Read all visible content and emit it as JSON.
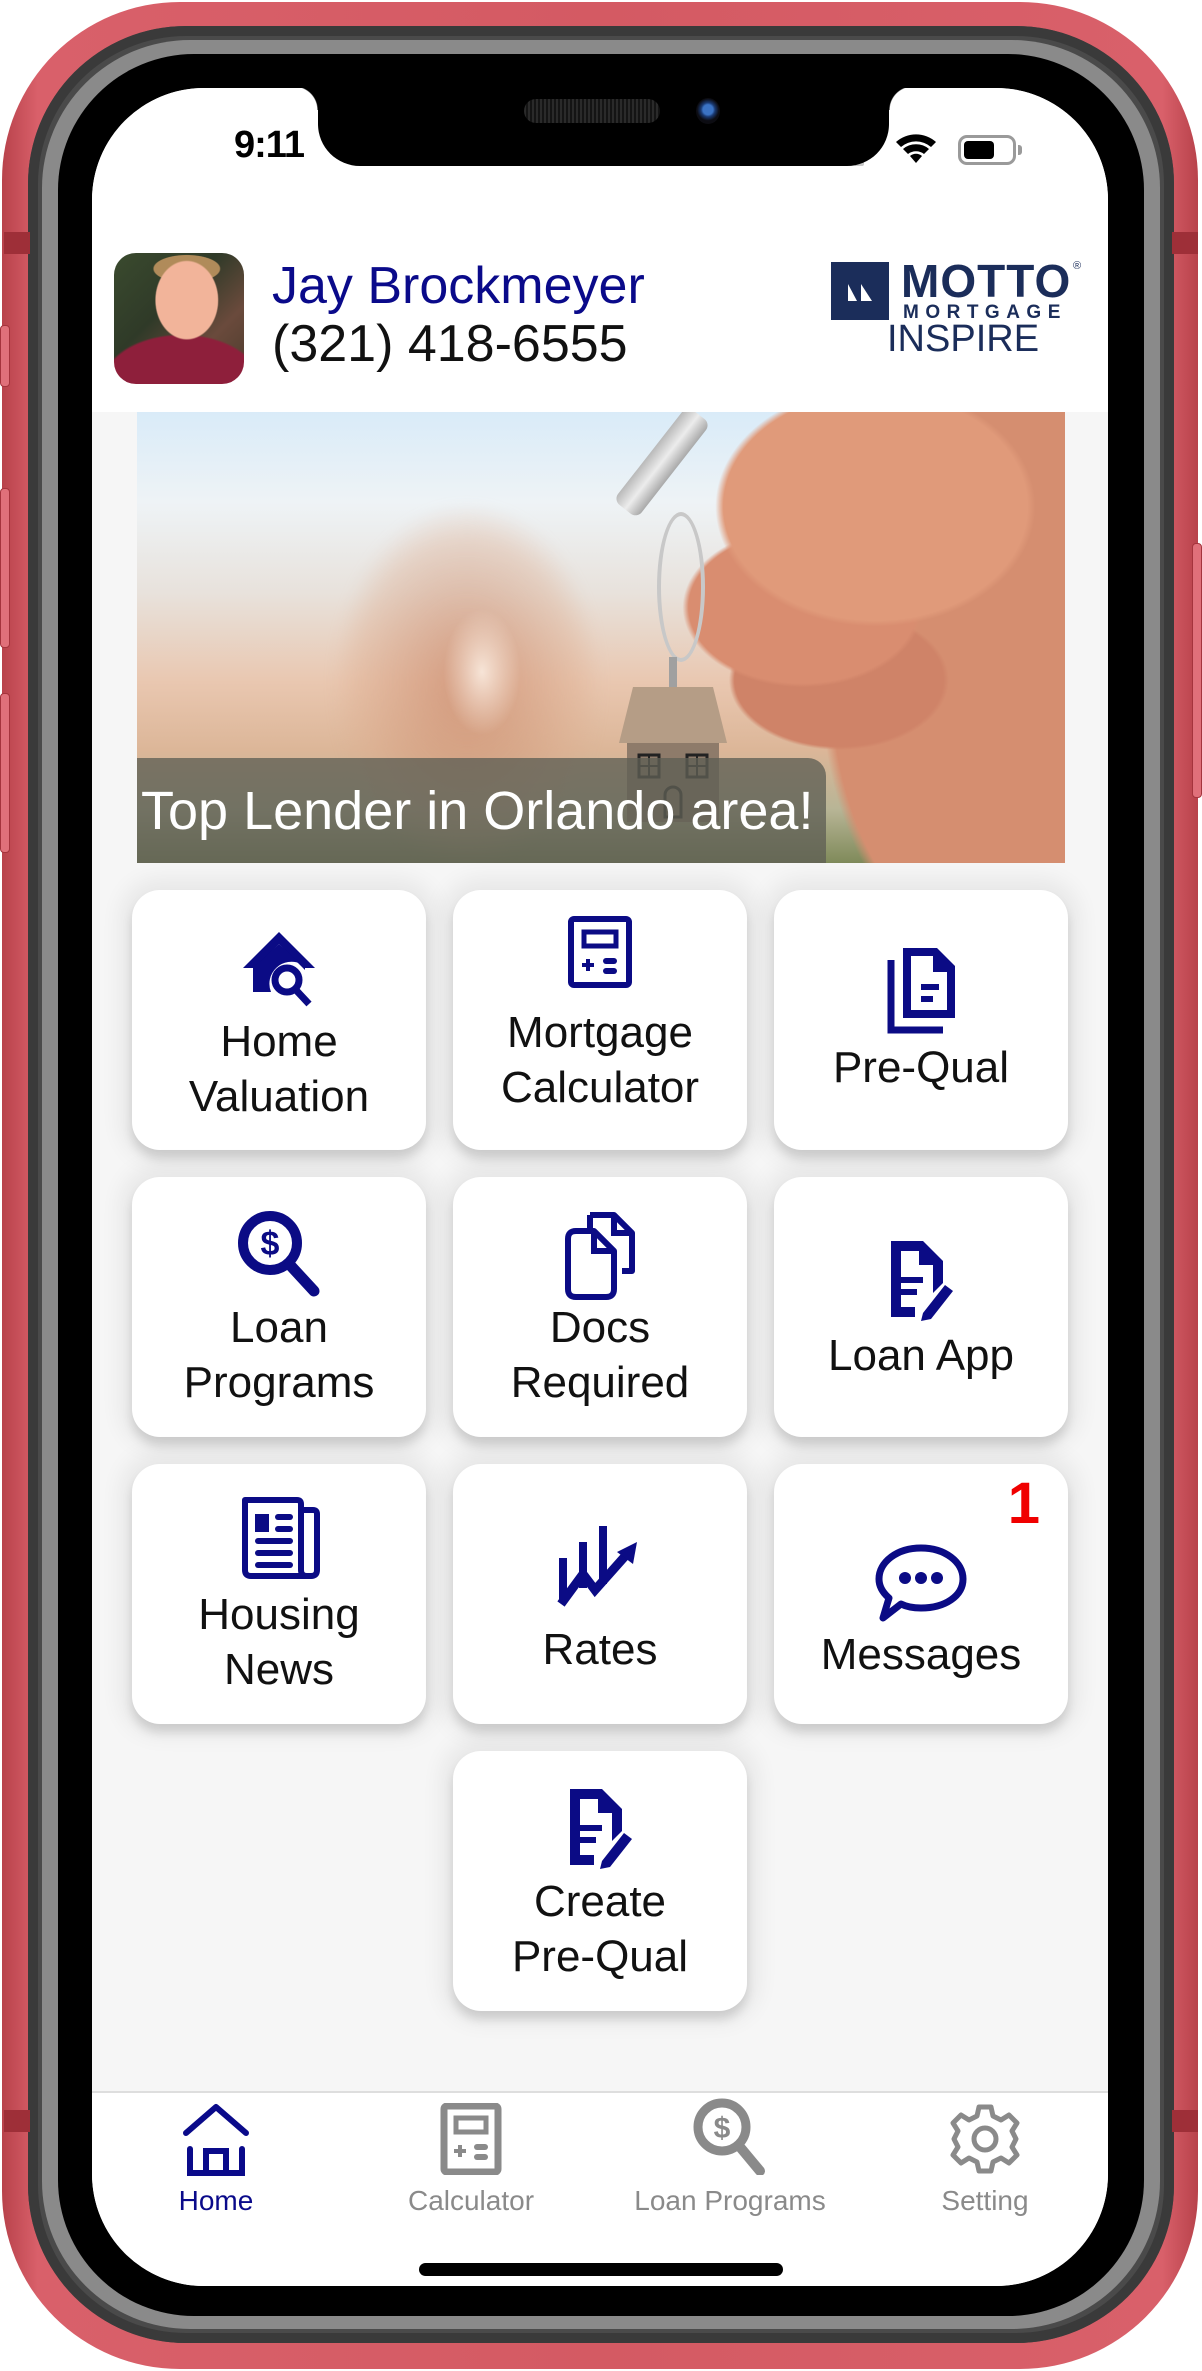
{
  "status_bar": {
    "time": "9:11",
    "icons": [
      "cellular-signal-icon",
      "wifi-icon",
      "battery-icon"
    ]
  },
  "header": {
    "agent_name": "Jay Brockmeyer",
    "agent_phone": "(321) 418-6555",
    "avatar": "agent-photo",
    "logo": {
      "brand": "MOTTO",
      "registered_mark": "®",
      "subtitle": "MORTGAGE",
      "office": "INSPIRE"
    }
  },
  "banner": {
    "caption": "Top Lender in Orlando area!",
    "image": "hand-holding-house-keychain"
  },
  "tiles": [
    {
      "label_lines": [
        "Home",
        "Valuation"
      ],
      "icon": "home-search-icon"
    },
    {
      "label_lines": [
        "Mortgage",
        "Calculator"
      ],
      "icon": "calculator-icon"
    },
    {
      "label_lines": [
        "Pre-Qual"
      ],
      "icon": "document-copy-icon"
    },
    {
      "label_lines": [
        "Loan",
        "Programs"
      ],
      "icon": "dollar-search-icon"
    },
    {
      "label_lines": [
        "Docs",
        "Required"
      ],
      "icon": "documents-icon"
    },
    {
      "label_lines": [
        "Loan App"
      ],
      "icon": "document-edit-icon"
    },
    {
      "label_lines": [
        "Housing",
        "News"
      ],
      "icon": "newspaper-icon"
    },
    {
      "label_lines": [
        "Rates"
      ],
      "icon": "chart-trend-icon"
    },
    {
      "label_lines": [
        "Messages"
      ],
      "icon": "chat-bubble-icon",
      "badge": "1"
    },
    {
      "label_lines": [
        "Create",
        "Pre-Qual"
      ],
      "icon": "document-edit-icon"
    }
  ],
  "tab_bar": {
    "tabs": [
      {
        "label": "Home",
        "icon": "home-icon",
        "active": true
      },
      {
        "label": "Calculator",
        "icon": "calculator-icon",
        "active": false
      },
      {
        "label": "Loan Programs",
        "icon": "dollar-search-icon",
        "active": false
      },
      {
        "label": "Setting",
        "icon": "gear-icon",
        "active": false
      }
    ]
  },
  "colors": {
    "accent": "#0a0a8a",
    "icon_blue": "#0b0b85",
    "badge_red": "#f00000",
    "tab_inactive": "#8a8a8a",
    "logo_navy": "#1b2d5a",
    "frame_red": "#d45a63"
  }
}
